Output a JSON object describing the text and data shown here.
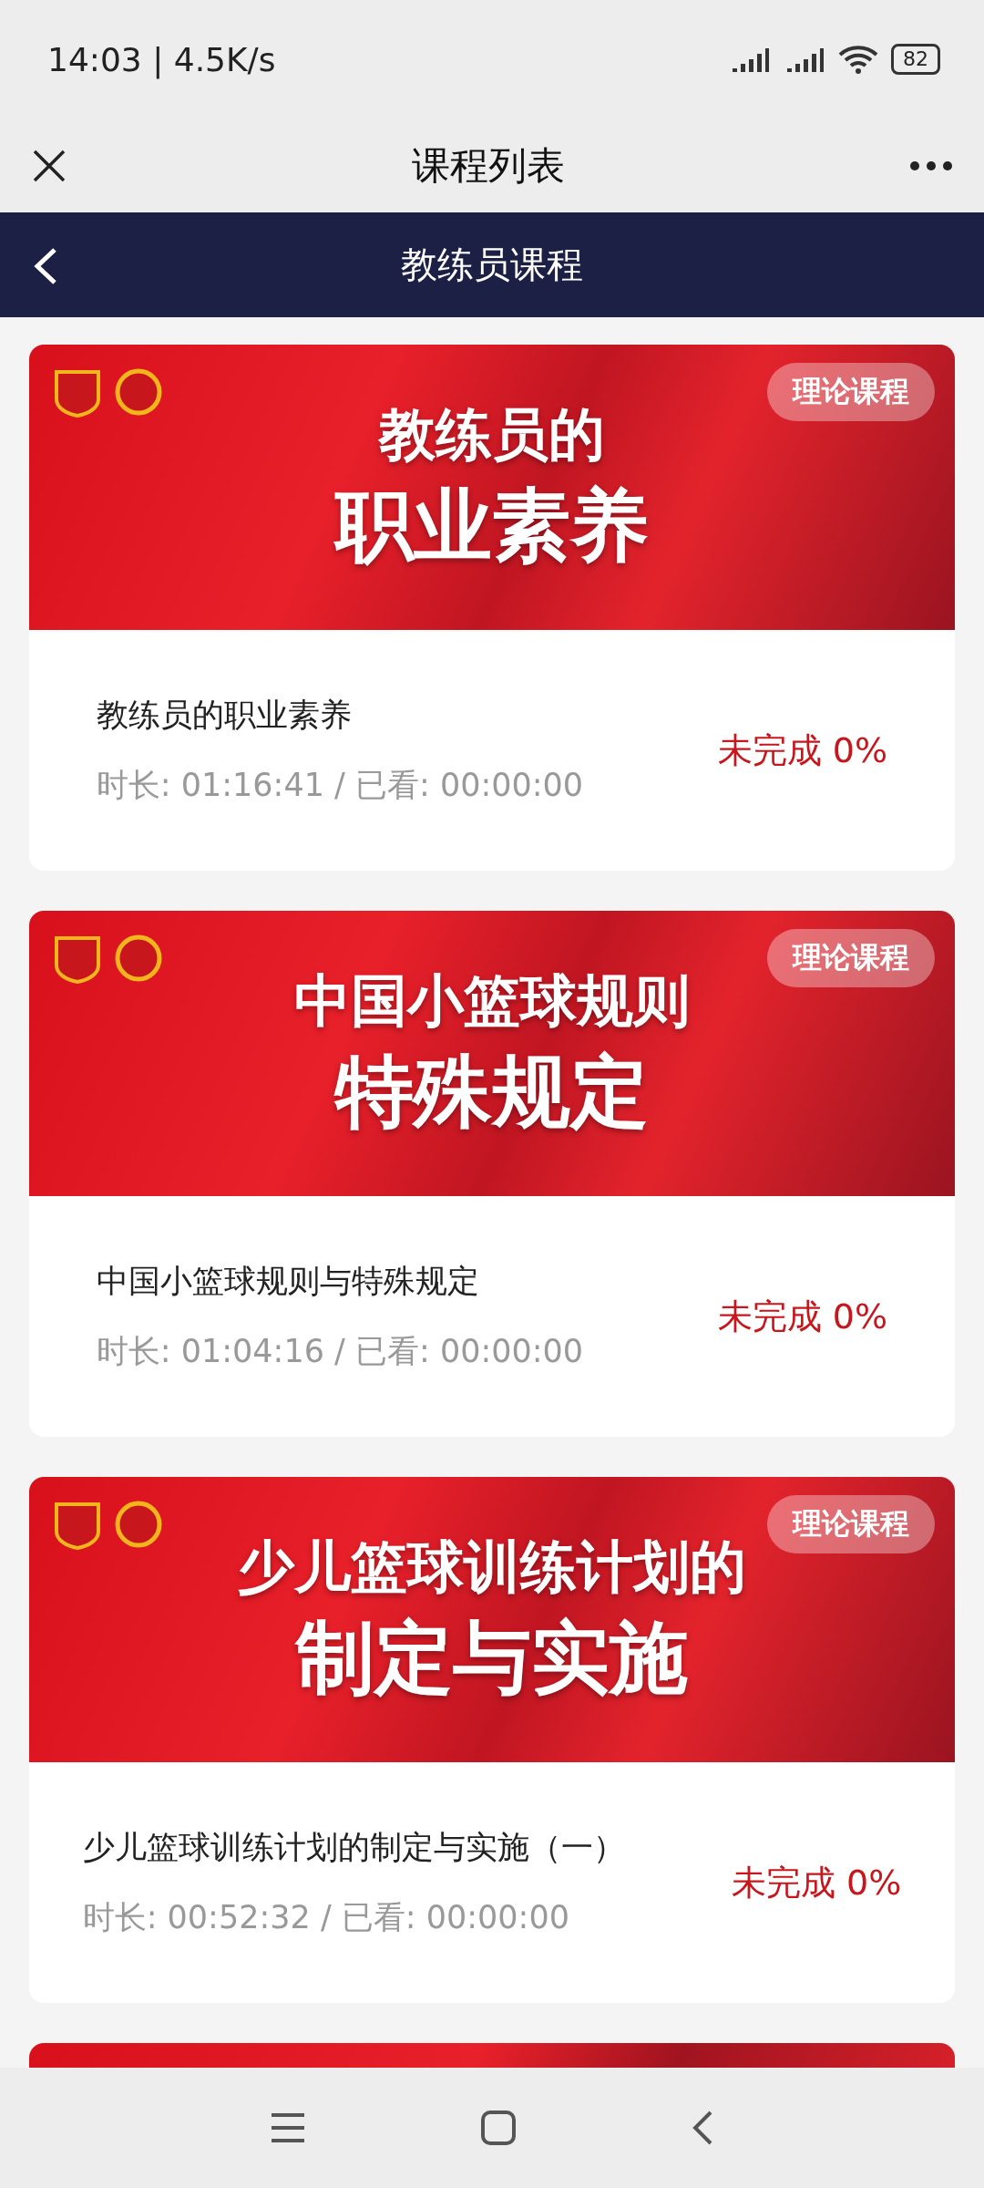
{
  "status_bar": {
    "time": "14:03 | 4.5K/s",
    "battery": "82"
  },
  "top_bar": {
    "title": "课程列表"
  },
  "nav_bar": {
    "title": "教练员课程"
  },
  "courses": [
    {
      "banner_lines": [
        "教练员的",
        "职业素养"
      ],
      "tag": "理论课程",
      "title": "教练员的职业素养",
      "meta": "时长: 01:16:41 / 已看: 00:00:00",
      "status": "未完成 0%",
      "completed": false
    },
    {
      "banner_lines": [
        "中国小篮球规则",
        "特殊规定"
      ],
      "tag": "理论课程",
      "title": "中国小篮球规则与特殊规定",
      "meta": "时长: 01:04:16 / 已看: 00:00:00",
      "status": "未完成 0%",
      "completed": false
    },
    {
      "banner_lines": [
        "少儿篮球训练计划的",
        "制定与实施"
      ],
      "tag": "理论课程",
      "title": "少儿篮球训练计划的制定与实施（一）",
      "meta": "时长: 00:52:32 / 已看: 00:00:00",
      "status": "未完成 0%",
      "completed": false
    }
  ]
}
